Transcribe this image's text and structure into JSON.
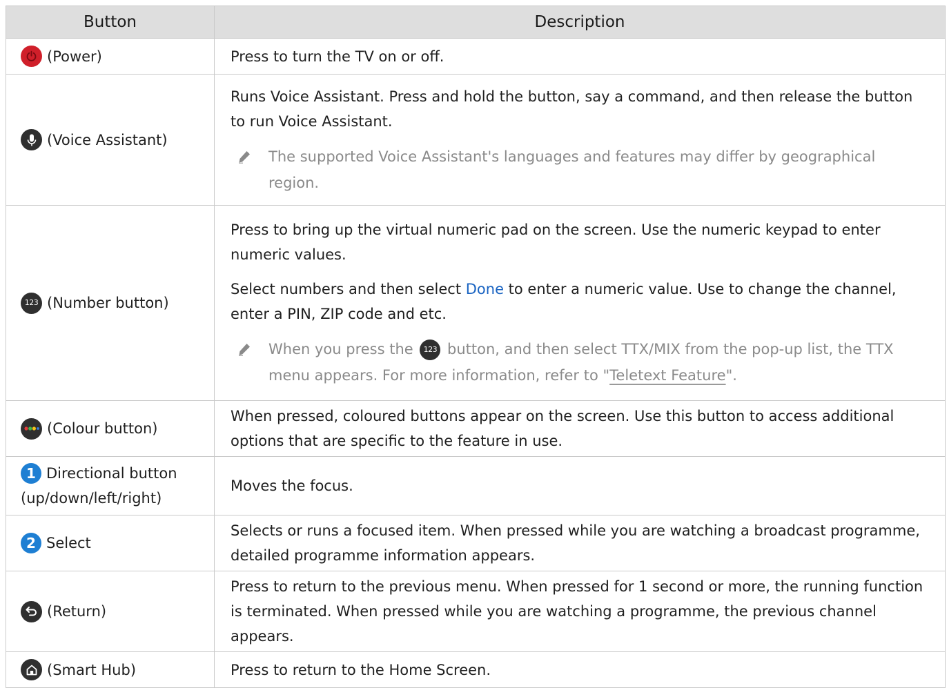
{
  "headers": {
    "button": "Button",
    "description": "Description"
  },
  "rows": [
    {
      "button_label": "(Power)",
      "icon": "power-icon",
      "desc": "Press to turn the TV on or off."
    },
    {
      "button_label": "(Voice Assistant)",
      "icon": "microphone-icon",
      "desc": "Runs Voice Assistant. Press and hold the button, say a command, and then release the button to run Voice Assistant.",
      "note": "The supported Voice Assistant's languages and features may differ by geographical region."
    },
    {
      "button_label": "(Number button)",
      "icon": "number-123-icon",
      "icon_text": "123",
      "desc": "Press to bring up the virtual numeric pad on the screen. Use the numeric keypad to enter numeric values.",
      "desc2_before": "Select numbers and then select ",
      "desc2_done": "Done",
      "desc2_after": " to enter a numeric value. Use to change the channel, enter a PIN, ZIP code and etc.",
      "note_before": "When you press the ",
      "note_mid": " button, and then select TTX/MIX from the pop-up list, the TTX menu appears. For more information, refer to \"",
      "note_link": "Teletext Feature",
      "note_after": "\"."
    },
    {
      "button_label": "(Colour button)",
      "icon": "colour-dots-icon",
      "desc": "When pressed, coloured buttons appear on the screen. Use this button to access additional options that are specific to the feature in use."
    },
    {
      "badge": "1",
      "button_label": "Directional button",
      "button_label2": "(up/down/left/right)",
      "desc": "Moves the focus."
    },
    {
      "badge": "2",
      "button_label": "Select",
      "desc": "Selects or runs a focused item. When pressed while you are watching a broadcast programme, detailed programme information appears."
    },
    {
      "button_label": "(Return)",
      "icon": "return-arrow-icon",
      "desc": "Press to return to the previous menu. When pressed for 1 second or more, the running function is terminated. When pressed while you are watching a programme, the previous channel appears."
    },
    {
      "button_label": "(Smart Hub)",
      "icon": "home-icon",
      "desc": "Press to return to the Home Screen."
    }
  ],
  "colors": {
    "header_bg": "#dedede",
    "border": "#c9c9c9",
    "power_red": "#d01f2a",
    "badge_blue": "#1e7fd3",
    "done_blue": "#1a64c2",
    "note_gray": "#8a8a8a"
  }
}
